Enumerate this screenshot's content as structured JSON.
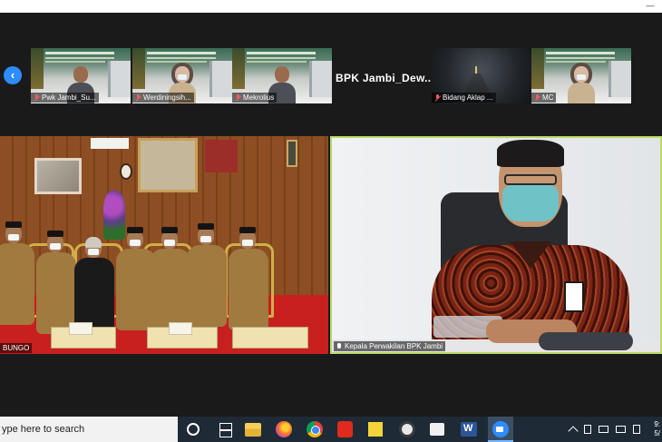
{
  "window": {
    "minimize_label": "—"
  },
  "thumbnails": [
    {
      "name": "Pwk Jambi_Su...",
      "muted": true,
      "kind": "banner",
      "person": "male"
    },
    {
      "name": "Werdiningsih...",
      "muted": true,
      "kind": "banner",
      "person": "hijab"
    },
    {
      "name": "Mekrolius",
      "muted": true,
      "kind": "banner",
      "person": "male"
    },
    {
      "name": "BPK  Jambi_Dew...",
      "muted": false,
      "kind": "name-only"
    },
    {
      "name": "Bidang Aklap ...",
      "muted": true,
      "kind": "road"
    },
    {
      "name": "MC",
      "muted": true,
      "kind": "banner",
      "person": "hijab"
    }
  ],
  "nav": {
    "prev_label": "‹"
  },
  "room_video": {
    "label": "BUNGO"
  },
  "speaker_video": {
    "label": "Kepala Perwakilan BPK Jambi"
  },
  "taskbar": {
    "search_placeholder": "ype here to search",
    "time": "9:",
    "date": "5/",
    "apps": [
      "cortana",
      "task-view",
      "file-explorer",
      "firefox",
      "chrome",
      "acrobat",
      "sticky-notes",
      "obs",
      "snipping",
      "word",
      "zoom"
    ]
  },
  "colors": {
    "accent": "#2d8cff",
    "active_speaker_border": "#b9d96a",
    "muted_red": "#ff5a5a",
    "taskbar": "#1e2a36"
  }
}
